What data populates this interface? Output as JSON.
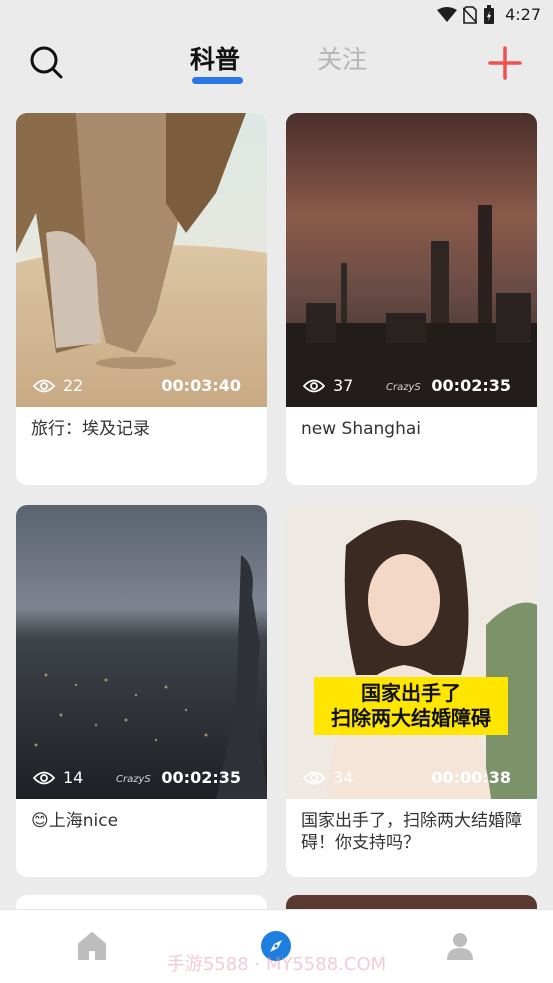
{
  "status_bar": {
    "time": "4:27"
  },
  "header": {
    "tabs": [
      {
        "label": "科普",
        "active": true
      },
      {
        "label": "关注",
        "active": false
      }
    ],
    "accent_color": "#2a76e8",
    "add_color": "#f0504e"
  },
  "videos": [
    {
      "views": "22",
      "duration": "00:03:40",
      "title": "旅行：埃及记录"
    },
    {
      "views": "37",
      "duration": "00:02:35",
      "title": "new Shanghai",
      "watermark": "CrazyS"
    },
    {
      "views": "14",
      "duration": "00:02:35",
      "title": "😊上海nice",
      "watermark": "CrazyS"
    },
    {
      "views": "34",
      "duration": "00:00:38",
      "title": "国家出手了，扫除两大结婚障碍！你支持吗？",
      "overlay_line1": "国家出手了",
      "overlay_line2": "扫除两大结婚障碍"
    }
  ],
  "bottom_nav": {
    "items": [
      {
        "icon": "home-icon",
        "active": false
      },
      {
        "icon": "compass-icon",
        "active": true
      },
      {
        "icon": "user-icon",
        "active": false
      }
    ],
    "watermark": "手游5588 · MY5588.COM"
  }
}
